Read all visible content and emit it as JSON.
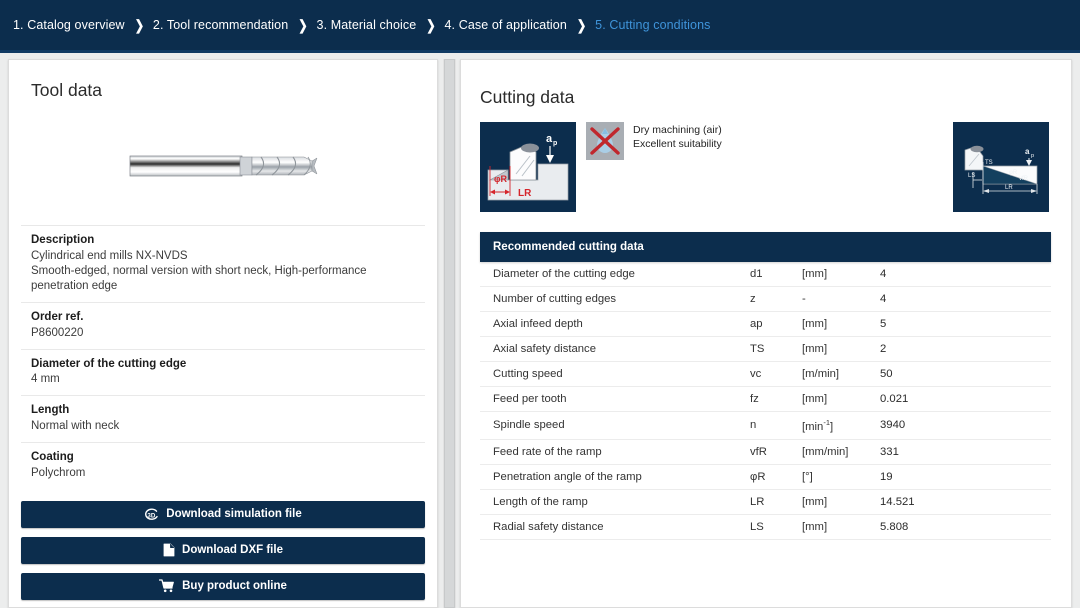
{
  "breadcrumb": {
    "separator": "❯",
    "steps": [
      {
        "label": "1. Catalog overview",
        "active": false
      },
      {
        "label": "2. Tool recommendation",
        "active": false
      },
      {
        "label": "3. Material choice",
        "active": false
      },
      {
        "label": "4. Case of application",
        "active": false
      },
      {
        "label": "5. Cutting conditions",
        "active": true
      }
    ]
  },
  "colors": {
    "header_navy": "#0c2d4d",
    "active_crumb": "#3f94da",
    "page_bg": "#eceded",
    "panel_bg": "#ffffff"
  },
  "tool_panel": {
    "title": "Tool data",
    "image_alt": "cylindrical-end-mill",
    "specs": [
      {
        "label": "Description",
        "value": "Cylindrical end mills   NX-NVDS\nSmooth-edged, normal version with short neck, High-performance penetration edge"
      },
      {
        "label": "Order ref.",
        "value": "P8600220"
      },
      {
        "label": "Diameter of the cutting edge",
        "value": "4 mm"
      },
      {
        "label": "Length",
        "value": "Normal with neck"
      },
      {
        "label": "Coating",
        "value": "Polychrom"
      }
    ],
    "buttons": [
      {
        "label": "Download simulation file",
        "icon": "3d-icon"
      },
      {
        "label": "Download DXF file",
        "icon": "document-icon"
      },
      {
        "label": "Buy product online",
        "icon": "shopping-cart-icon"
      }
    ]
  },
  "cutting_panel": {
    "title": "Cutting data",
    "ramp_diagram": {
      "name": "ramping-diagram",
      "labels": [
        "ap",
        "φR",
        "LR"
      ]
    },
    "coolant": {
      "icon": "no-coolant-dry-icon",
      "line1": "Dry machining (air)",
      "line2": "Excellent suitability"
    },
    "side_diagram": {
      "name": "ramp-geometry-diagram",
      "labels": [
        "ap",
        "TS",
        "LS",
        "LR",
        "φR",
        "vfR"
      ]
    },
    "table": {
      "header": "Recommended cutting data",
      "rows": [
        {
          "name": "Diameter of the cutting edge",
          "symbol": "d1",
          "unit": "[mm]",
          "value": "4"
        },
        {
          "name": "Number of cutting edges",
          "symbol": "z",
          "unit": "-",
          "value": "4"
        },
        {
          "name": "Axial infeed depth",
          "symbol": "ap",
          "unit": "[mm]",
          "value": "5"
        },
        {
          "name": "Axial safety distance",
          "symbol": "TS",
          "unit": "[mm]",
          "value": "2"
        },
        {
          "name": "Cutting speed",
          "symbol": "vc",
          "unit": "[m/min]",
          "value": "50"
        },
        {
          "name": "Feed per tooth",
          "symbol": "fz",
          "unit": "[mm]",
          "value": "0.021"
        },
        {
          "name": "Spindle speed",
          "symbol": "n",
          "unit": "[min-1]",
          "unit_html": true,
          "value": "3940"
        },
        {
          "name": "Feed rate of the ramp",
          "symbol": "vfR",
          "unit": "[mm/min]",
          "value": "331"
        },
        {
          "name": "Penetration angle of the ramp",
          "symbol": "φR",
          "unit": "[°]",
          "value": "19"
        },
        {
          "name": "Length of the ramp",
          "symbol": "LR",
          "unit": "[mm]",
          "value": "14.521"
        },
        {
          "name": "Radial safety distance",
          "symbol": "LS",
          "unit": "[mm]",
          "value": "5.808"
        }
      ]
    }
  }
}
